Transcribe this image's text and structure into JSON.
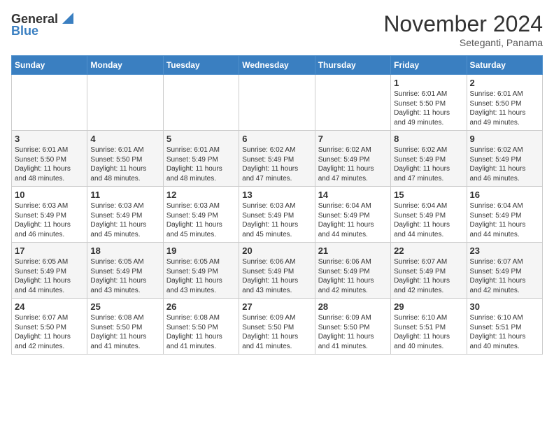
{
  "header": {
    "logo_general": "General",
    "logo_blue": "Blue",
    "month": "November 2024",
    "location": "Seteganti, Panama"
  },
  "weekdays": [
    "Sunday",
    "Monday",
    "Tuesday",
    "Wednesday",
    "Thursday",
    "Friday",
    "Saturday"
  ],
  "weeks": [
    [
      {
        "day": "",
        "info": ""
      },
      {
        "day": "",
        "info": ""
      },
      {
        "day": "",
        "info": ""
      },
      {
        "day": "",
        "info": ""
      },
      {
        "day": "",
        "info": ""
      },
      {
        "day": "1",
        "info": "Sunrise: 6:01 AM\nSunset: 5:50 PM\nDaylight: 11 hours\nand 49 minutes."
      },
      {
        "day": "2",
        "info": "Sunrise: 6:01 AM\nSunset: 5:50 PM\nDaylight: 11 hours\nand 49 minutes."
      }
    ],
    [
      {
        "day": "3",
        "info": "Sunrise: 6:01 AM\nSunset: 5:50 PM\nDaylight: 11 hours\nand 48 minutes."
      },
      {
        "day": "4",
        "info": "Sunrise: 6:01 AM\nSunset: 5:50 PM\nDaylight: 11 hours\nand 48 minutes."
      },
      {
        "day": "5",
        "info": "Sunrise: 6:01 AM\nSunset: 5:49 PM\nDaylight: 11 hours\nand 48 minutes."
      },
      {
        "day": "6",
        "info": "Sunrise: 6:02 AM\nSunset: 5:49 PM\nDaylight: 11 hours\nand 47 minutes."
      },
      {
        "day": "7",
        "info": "Sunrise: 6:02 AM\nSunset: 5:49 PM\nDaylight: 11 hours\nand 47 minutes."
      },
      {
        "day": "8",
        "info": "Sunrise: 6:02 AM\nSunset: 5:49 PM\nDaylight: 11 hours\nand 47 minutes."
      },
      {
        "day": "9",
        "info": "Sunrise: 6:02 AM\nSunset: 5:49 PM\nDaylight: 11 hours\nand 46 minutes."
      }
    ],
    [
      {
        "day": "10",
        "info": "Sunrise: 6:03 AM\nSunset: 5:49 PM\nDaylight: 11 hours\nand 46 minutes."
      },
      {
        "day": "11",
        "info": "Sunrise: 6:03 AM\nSunset: 5:49 PM\nDaylight: 11 hours\nand 45 minutes."
      },
      {
        "day": "12",
        "info": "Sunrise: 6:03 AM\nSunset: 5:49 PM\nDaylight: 11 hours\nand 45 minutes."
      },
      {
        "day": "13",
        "info": "Sunrise: 6:03 AM\nSunset: 5:49 PM\nDaylight: 11 hours\nand 45 minutes."
      },
      {
        "day": "14",
        "info": "Sunrise: 6:04 AM\nSunset: 5:49 PM\nDaylight: 11 hours\nand 44 minutes."
      },
      {
        "day": "15",
        "info": "Sunrise: 6:04 AM\nSunset: 5:49 PM\nDaylight: 11 hours\nand 44 minutes."
      },
      {
        "day": "16",
        "info": "Sunrise: 6:04 AM\nSunset: 5:49 PM\nDaylight: 11 hours\nand 44 minutes."
      }
    ],
    [
      {
        "day": "17",
        "info": "Sunrise: 6:05 AM\nSunset: 5:49 PM\nDaylight: 11 hours\nand 44 minutes."
      },
      {
        "day": "18",
        "info": "Sunrise: 6:05 AM\nSunset: 5:49 PM\nDaylight: 11 hours\nand 43 minutes."
      },
      {
        "day": "19",
        "info": "Sunrise: 6:05 AM\nSunset: 5:49 PM\nDaylight: 11 hours\nand 43 minutes."
      },
      {
        "day": "20",
        "info": "Sunrise: 6:06 AM\nSunset: 5:49 PM\nDaylight: 11 hours\nand 43 minutes."
      },
      {
        "day": "21",
        "info": "Sunrise: 6:06 AM\nSunset: 5:49 PM\nDaylight: 11 hours\nand 42 minutes."
      },
      {
        "day": "22",
        "info": "Sunrise: 6:07 AM\nSunset: 5:49 PM\nDaylight: 11 hours\nand 42 minutes."
      },
      {
        "day": "23",
        "info": "Sunrise: 6:07 AM\nSunset: 5:49 PM\nDaylight: 11 hours\nand 42 minutes."
      }
    ],
    [
      {
        "day": "24",
        "info": "Sunrise: 6:07 AM\nSunset: 5:50 PM\nDaylight: 11 hours\nand 42 minutes."
      },
      {
        "day": "25",
        "info": "Sunrise: 6:08 AM\nSunset: 5:50 PM\nDaylight: 11 hours\nand 41 minutes."
      },
      {
        "day": "26",
        "info": "Sunrise: 6:08 AM\nSunset: 5:50 PM\nDaylight: 11 hours\nand 41 minutes."
      },
      {
        "day": "27",
        "info": "Sunrise: 6:09 AM\nSunset: 5:50 PM\nDaylight: 11 hours\nand 41 minutes."
      },
      {
        "day": "28",
        "info": "Sunrise: 6:09 AM\nSunset: 5:50 PM\nDaylight: 11 hours\nand 41 minutes."
      },
      {
        "day": "29",
        "info": "Sunrise: 6:10 AM\nSunset: 5:51 PM\nDaylight: 11 hours\nand 40 minutes."
      },
      {
        "day": "30",
        "info": "Sunrise: 6:10 AM\nSunset: 5:51 PM\nDaylight: 11 hours\nand 40 minutes."
      }
    ]
  ]
}
